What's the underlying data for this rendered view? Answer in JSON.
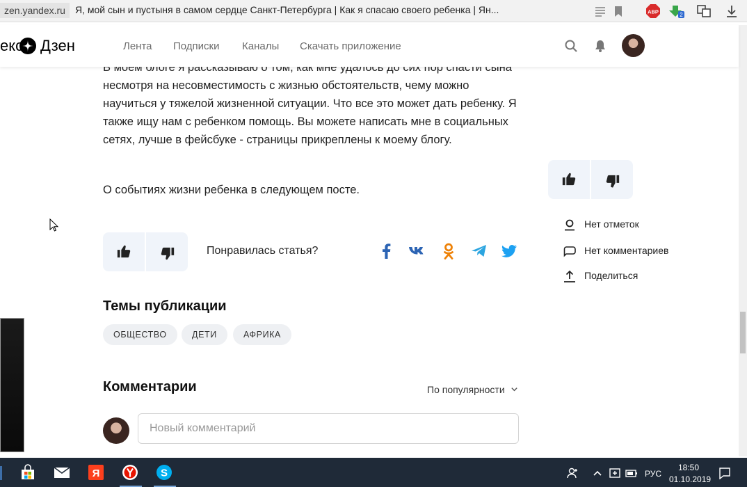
{
  "browser": {
    "domain": "zen.yandex.ru",
    "page_title": "Я, мой сын и пустыня в самом сердце Санкт-Петербурга | Как я спасаю своего ребенка | Ян..."
  },
  "header": {
    "logo_part1": "екс",
    "logo_part2": "Дзен",
    "nav": [
      "Лента",
      "Подписки",
      "Каналы",
      "Скачать приложение"
    ]
  },
  "article": {
    "paragraph1": "В моем блоге я рассказываю о том, как мне удалось до сих пор спасти сына несмотря на несовместимость с жизнью обстоятельств, чему можно научиться у тяжелой жизненной ситуации. Что все это может дать ребенку. Я также ищу нам с ребенком помощь. Вы можете написать мне в социальных сетях, лучше в фейсбуке - страницы прикреплены к моему блогу.",
    "paragraph2": "О событиях жизни ребенка в следующем посте.",
    "liked_question": "Понравилась статья?"
  },
  "sidebar": {
    "marks": "Нет отметок",
    "comments": "Нет комментариев",
    "share": "Поделиться"
  },
  "topics": {
    "title": "Темы публикации",
    "tags": [
      "ОБЩЕСТВО",
      "ДЕТИ",
      "АФРИКА"
    ]
  },
  "comments": {
    "title": "Комментарии",
    "sort_label": "По популярности",
    "placeholder": "Новый комментарий"
  },
  "taskbar": {
    "language": "РУС",
    "time": "18:50",
    "date": "01.10.2019"
  },
  "colors": {
    "accent_blue": "#2c64b4",
    "ok_orange": "#ee8208",
    "telegram": "#2ca5e0",
    "twitter": "#1da1f2",
    "taskbar_bg": "#1f2a38"
  }
}
